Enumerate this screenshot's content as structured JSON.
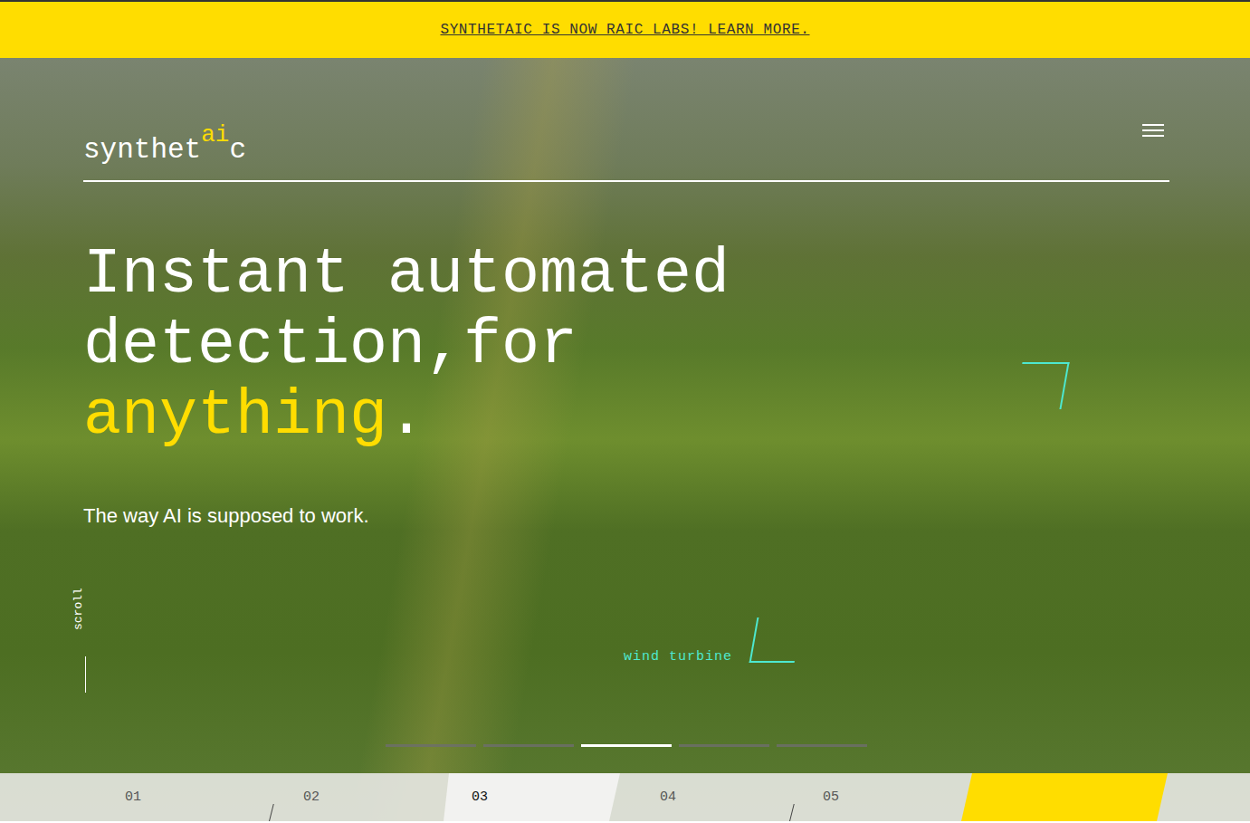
{
  "banner": {
    "text": "SYNTHETAIC IS NOW RAIC LABS! LEARN MORE."
  },
  "logo": {
    "prefix": "synthet",
    "highlight": "ai",
    "suffix": "c"
  },
  "headline": {
    "lines": [
      "Instant automated",
      "detection,for"
    ],
    "highlight": "anything",
    "end": "."
  },
  "subtitle": "The way AI is supposed to work.",
  "scroll_label": "scroll",
  "detection": {
    "label": "wind turbine"
  },
  "slides": [
    {
      "selected": false
    },
    {
      "selected": false
    },
    {
      "selected": true
    },
    {
      "selected": false
    },
    {
      "selected": false
    }
  ],
  "tabs": [
    {
      "label": "01",
      "selected": false
    },
    {
      "label": "02",
      "selected": false
    },
    {
      "label": "03",
      "selected": true
    },
    {
      "label": "04",
      "selected": false
    },
    {
      "label": "05",
      "selected": false
    }
  ]
}
